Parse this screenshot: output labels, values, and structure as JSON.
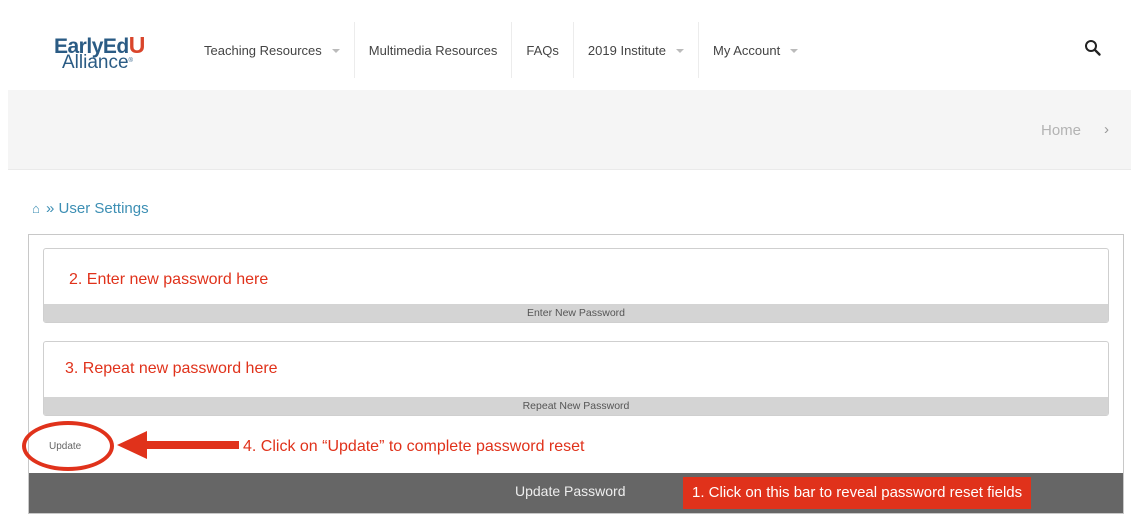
{
  "logo": {
    "line1": "EarlyEd",
    "line1_accent": "U",
    "line2": "Alliance",
    "mark": "®"
  },
  "nav": {
    "items": [
      {
        "label": "Teaching Resources",
        "has_dropdown": true
      },
      {
        "label": "Multimedia Resources",
        "has_dropdown": false
      },
      {
        "label": "FAQs",
        "has_dropdown": false
      },
      {
        "label": "2019 Institute",
        "has_dropdown": true
      },
      {
        "label": "My Account",
        "has_dropdown": true
      }
    ],
    "search_icon": "search-icon"
  },
  "top_breadcrumb": {
    "home": "Home",
    "chevron": "›"
  },
  "page_breadcrumb": {
    "home_icon": "⌂",
    "separator": "»",
    "current": "User Settings"
  },
  "form": {
    "new_password": {
      "note": "2. Enter new password here",
      "label": "Enter New Password",
      "value": ""
    },
    "repeat_password": {
      "note": "3. Repeat new password here",
      "label": "Repeat New Password",
      "value": ""
    },
    "update_button": "Update",
    "update_note": "4. Click on “Update” to complete password reset",
    "update_bar": {
      "label": "Update Password",
      "note": "1. Click on this bar to reveal password reset fields"
    }
  },
  "colors": {
    "annotation": "#e0321b",
    "link": "#3d8fb4",
    "brand": "#2a5b84",
    "bar": "#666666"
  }
}
